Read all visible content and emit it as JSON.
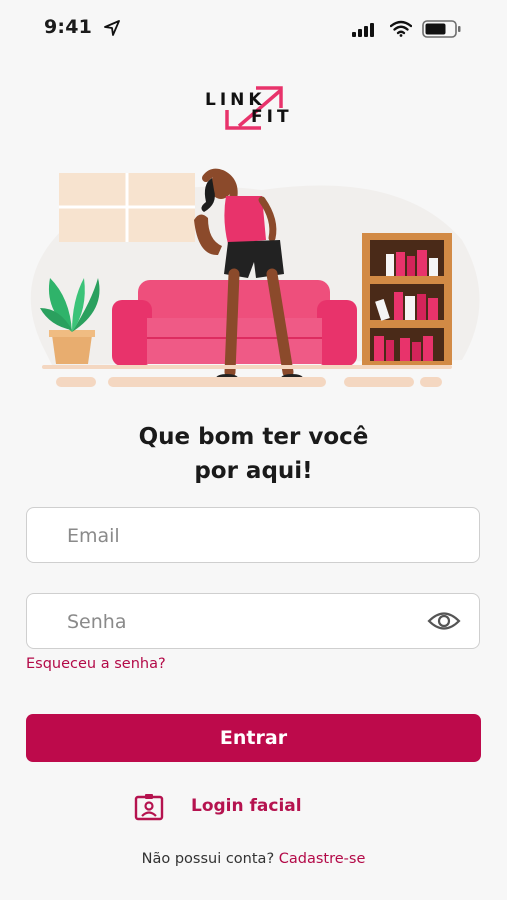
{
  "status_bar": {
    "time": "9:41"
  },
  "logo": {
    "line1": "LINK",
    "line2": "FIT"
  },
  "title": {
    "line1": "Que bom ter você",
    "line2": "por aqui!"
  },
  "form": {
    "email_placeholder": "Email",
    "password_placeholder": "Senha",
    "forgot_password": "Esqueceu a senha?",
    "submit_label": "Entrar"
  },
  "facial_login": {
    "label": "Login facial"
  },
  "signup": {
    "prompt": "Não possui conta?",
    "link": "Cadastre-se"
  },
  "colors": {
    "brand": "#bd0a4b",
    "accent_pink": "#e8336b",
    "background": "#f7f7f7"
  },
  "icons": [
    "location-arrow-icon",
    "cellular-signal-icon",
    "wifi-icon",
    "battery-icon",
    "eye-icon",
    "face-id-icon"
  ]
}
